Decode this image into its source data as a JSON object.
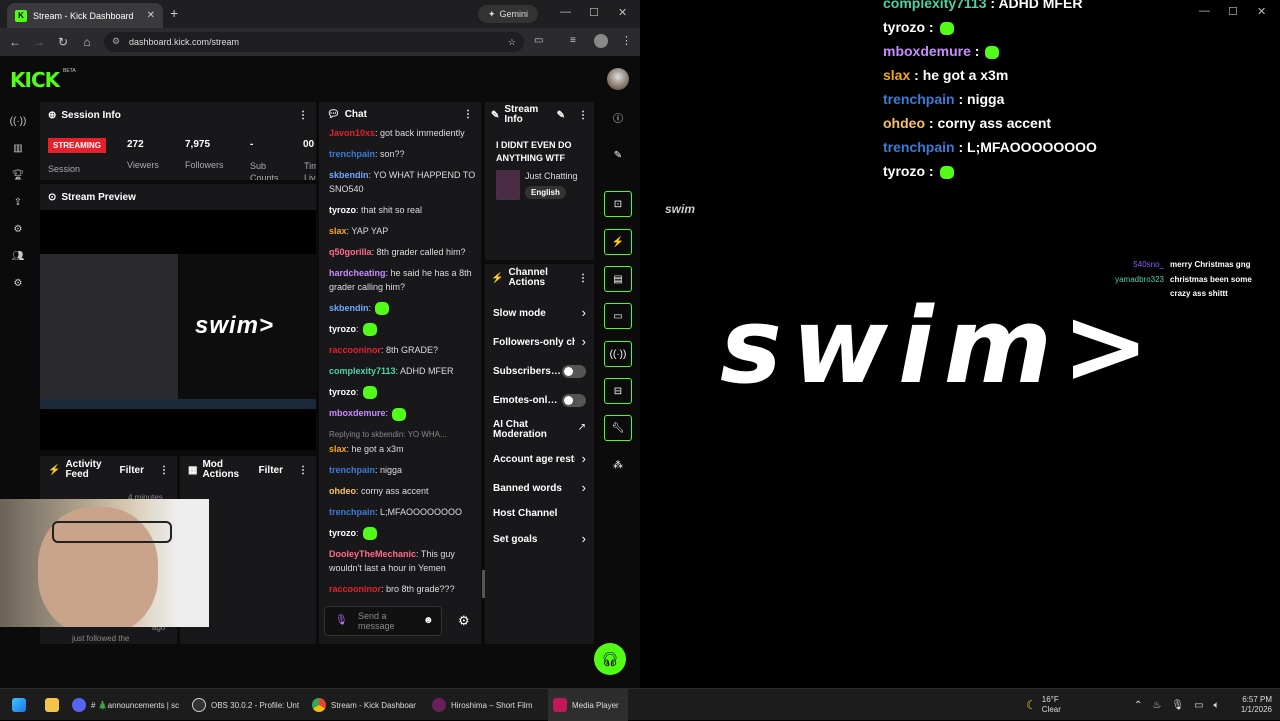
{
  "browser": {
    "tab_title": "Stream - Kick Dashboard",
    "gemini_label": "Gemini",
    "url": "dashboard.kick.com/stream"
  },
  "site": {
    "logo": "KICK",
    "beta": "BETA"
  },
  "session": {
    "title": "Session Info",
    "status": "STREAMING",
    "status_label": "Session",
    "viewers_value": "272",
    "viewers_label": "Viewers",
    "followers_value": "7,975",
    "followers_label": "Followers",
    "subs_value": "-",
    "subs_label": "Sub Counts",
    "time_value": "00",
    "time_label": "Tim Liv"
  },
  "preview": {
    "title": "Stream Preview",
    "swim_text": "swim>"
  },
  "activity": {
    "title": "Activity Feed",
    "filter": "Filter",
    "time": "4 minutes",
    "ago": "ago",
    "text": "just followed the"
  },
  "mod": {
    "title": "Mod Actions",
    "filter": "Filter"
  },
  "chat": {
    "title": "Chat",
    "send_placeholder": "Send a message",
    "replying": "Replying to skbendin: YO WHA...",
    "messages": [
      {
        "user": "Javon10xs",
        "color": "#e5202a",
        "text": ": got back immediently"
      },
      {
        "user": "trenchpain",
        "color": "#3a7bd5",
        "text": ": son??"
      },
      {
        "user": "skbendin",
        "color": "#6ea8ff",
        "text": ": YO WHAT HAPPEND TO SNO540"
      },
      {
        "user": "tyrozo",
        "color": "#ffffff",
        "text": ": that shit so real"
      },
      {
        "user": "slax",
        "color": "#f5a623",
        "text": ": YAP YAP"
      },
      {
        "user": "q50gorilla",
        "color": "#ff6b8a",
        "text": ": 8th grader called him?"
      },
      {
        "user": "hardcheating",
        "color": "#c78cff",
        "text": ": he said he has a 8th grader calling him?"
      },
      {
        "user": "skbendin",
        "color": "#6ea8ff",
        "text": ":"
      },
      {
        "user": "tyrozo",
        "color": "#ffffff",
        "text": ":"
      },
      {
        "user": "raccooninor",
        "color": "#e5202a",
        "text": ": 8th GRADE?"
      },
      {
        "user": "complexity7113",
        "color": "#4fd1a5",
        "text": ": ADHD MFER"
      },
      {
        "user": "tyrozo",
        "color": "#ffffff",
        "text": ":"
      },
      {
        "user": "mboxdemure",
        "color": "#c78cff",
        "text": ":"
      },
      {
        "user": "slax",
        "color": "#f5a623",
        "text": ": he got a x3m"
      },
      {
        "user": "trenchpain",
        "color": "#3a7bd5",
        "text": ": nigga"
      },
      {
        "user": "ohdeo",
        "color": "#f5c06b",
        "text": ": corny ass accent"
      },
      {
        "user": "trenchpain",
        "color": "#3a7bd5",
        "text": ": L;MFAOOOOOOOO"
      },
      {
        "user": "tyrozo",
        "color": "#ffffff",
        "text": ":"
      },
      {
        "user": "DooleyTheMechanic",
        "color": "#ff6b8a",
        "text": ": This guy wouldn't last a hour in Yemen"
      },
      {
        "user": "raccooninor",
        "color": "#e5202a",
        "text": ": bro 8th grade???"
      }
    ]
  },
  "stream_info": {
    "title": "Stream Info",
    "stream_title": "I DIDNT EVEN DO ANYTHING WTF",
    "category": "Just Chatting",
    "language": "English"
  },
  "channel_actions": {
    "title": "Channel Actions",
    "items": [
      {
        "label": "Slow mode",
        "kind": "chevron"
      },
      {
        "label": "Followers-only chat",
        "kind": "chevron"
      },
      {
        "label": "Subscribers-only",
        "kind": "toggle"
      },
      {
        "label": "Emotes-only mode",
        "kind": "toggle"
      },
      {
        "label": "AI Chat Moderation",
        "kind": "link"
      },
      {
        "label": "Account age restriction",
        "kind": "chevron"
      },
      {
        "label": "Banned words",
        "kind": "chevron"
      },
      {
        "label": "Host Channel",
        "kind": "none"
      },
      {
        "label": "Set goals",
        "kind": "chevron"
      }
    ]
  },
  "player": {
    "chat": [
      {
        "user": "complexity7113",
        "color": "#4fd1a5",
        "text": " : ADHD MFER"
      },
      {
        "user": "tyrozo",
        "color": "#ffffff",
        "text": " :"
      },
      {
        "user": "mboxdemure",
        "color": "#c78cff",
        "text": " :"
      },
      {
        "user": "slax",
        "color": "#f5a623",
        "text": " : he got a x3m"
      },
      {
        "user": "trenchpain",
        "color": "#3a7bd5",
        "text": " : nigga"
      },
      {
        "user": "ohdeo",
        "color": "#f5c06b",
        "text": " : corny ass accent"
      },
      {
        "user": "trenchpain",
        "color": "#3a7bd5",
        "text": " : L;MFAOOOOOOOO"
      },
      {
        "user": "tyrozo",
        "color": "#ffffff",
        "text": " :"
      }
    ],
    "small_swim": "swim",
    "big_swim": "swim>",
    "overlay_chat": [
      {
        "user": "540sno_",
        "color": "#8a5cff",
        "text": "merry Christmas gng"
      },
      {
        "user": "yamadbro323",
        "color": "#4fd1a5",
        "text": "christmas been some crazy ass shittt"
      }
    ]
  },
  "taskbar": {
    "discord": "# 🎄announcements | sc",
    "obs": "OBS 30.0.2 - Profile: Unt",
    "chrome": "Stream - Kick Dashboar",
    "hiroshima": "Hiroshima – Short Film",
    "media": "Media Player",
    "temp": "16°F",
    "weather": "Clear",
    "time": "6:57 PM",
    "date": "1/1/2026"
  }
}
